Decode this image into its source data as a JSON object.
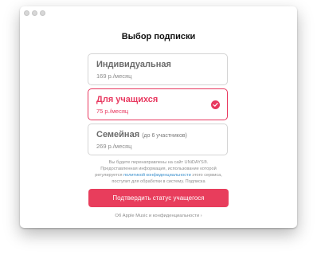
{
  "page": {
    "title": "Выбор подписки",
    "accent_color": "#e8385f"
  },
  "plans": [
    {
      "name": "Индивидуальная",
      "note": "",
      "price": "169 р./месяц",
      "selected": false
    },
    {
      "name": "Для учащихся",
      "note": "",
      "price": "75 р./месяц",
      "selected": true,
      "selected_icon": "checkmark-icon"
    },
    {
      "name": "Семейная",
      "note": "(до 6 участников)",
      "price": "269 р./месяц",
      "selected": false
    }
  ],
  "info": {
    "part1": "Вы будете перенаправлены на сайт UNiDAYS®. Предоставленная информация, использование которой регулируется ",
    "link": "политикой конфиденциальности",
    "part2": " этого сервиса, поступит для обработки в систему. Подписка"
  },
  "actions": {
    "confirm_label": "Подтвердить статус учащегося",
    "privacy_label": "Об Apple Music и конфиденциальности ›"
  }
}
